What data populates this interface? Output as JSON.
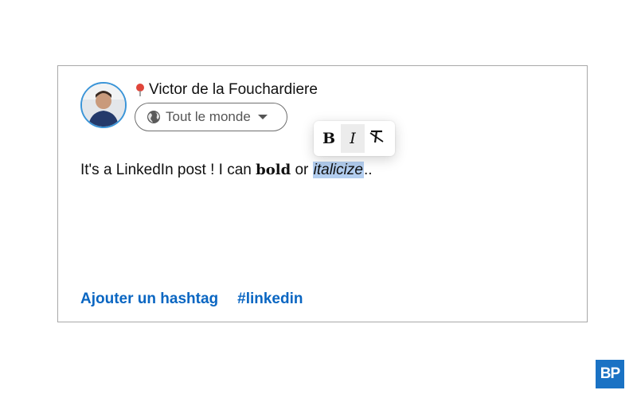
{
  "post": {
    "author_name": "Victor de la Fouchardiere",
    "audience_label": "Tout le monde",
    "text_before": "It's a LinkedIn post ! I can ",
    "text_bold": "bold",
    "text_middle": " or ",
    "text_italic": "italicize",
    "text_after": ".."
  },
  "toolbar": {
    "bold_label": "B",
    "italic_label": "I"
  },
  "hashtags": {
    "add_label": "Ajouter un hashtag",
    "tag_label": "#linkedin"
  },
  "logo": {
    "text": "BP"
  },
  "icons": {
    "pin": "pin-icon",
    "globe": "globe-icon",
    "caret": "caret-down-icon",
    "clear_format": "clear-format-icon"
  },
  "colors": {
    "link": "#0a66c2",
    "selection": "#b3cef0",
    "avatar_ring": "#3b95d8",
    "logo_bg": "#1a72c4"
  }
}
